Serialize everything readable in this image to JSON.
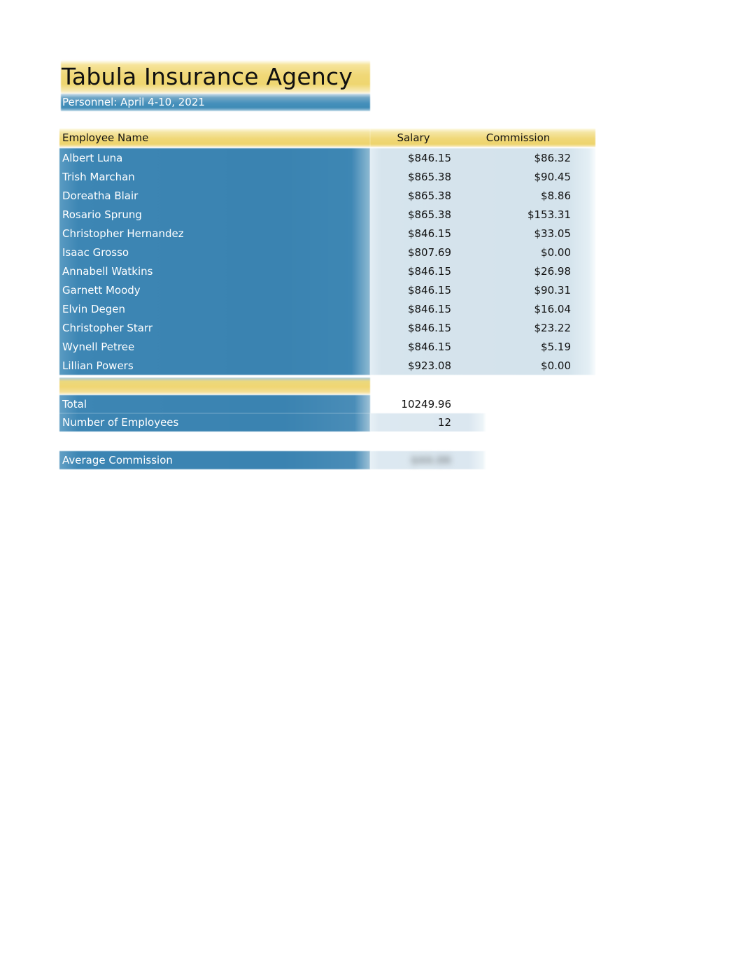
{
  "document": {
    "title": "Tabula Insurance Agency",
    "subtitle": "Personnel: April 4-10, 2021"
  },
  "table": {
    "headers": {
      "name": "Employee Name",
      "salary": "Salary",
      "commission": "Commission"
    },
    "rows": [
      {
        "name": "Albert Luna",
        "salary": "$846.15",
        "commission": "$86.32"
      },
      {
        "name": "Trish Marchan",
        "salary": "$865.38",
        "commission": "$90.45"
      },
      {
        "name": "Doreatha Blair",
        "salary": "$865.38",
        "commission": "$8.86"
      },
      {
        "name": "Rosario Sprung",
        "salary": "$865.38",
        "commission": "$153.31"
      },
      {
        "name": "Christopher Hernandez",
        "salary": "$846.15",
        "commission": "$33.05"
      },
      {
        "name": "Isaac Grosso",
        "salary": "$807.69",
        "commission": "$0.00"
      },
      {
        "name": "Annabell Watkins",
        "salary": "$846.15",
        "commission": "$26.98"
      },
      {
        "name": "Garnett Moody",
        "salary": "$846.15",
        "commission": "$90.31"
      },
      {
        "name": "Elvin Degen",
        "salary": "$846.15",
        "commission": "$16.04"
      },
      {
        "name": "Christopher Starr",
        "salary": "$846.15",
        "commission": "$23.22"
      },
      {
        "name": "Wynell Petree",
        "salary": "$846.15",
        "commission": "$5.19"
      },
      {
        "name": "Lillian Powers",
        "salary": "$923.08",
        "commission": "$0.00"
      }
    ]
  },
  "summary": {
    "total": {
      "label": "Total",
      "value": "10249.96"
    },
    "employee_count": {
      "label": "Number of Employees",
      "value": "12"
    },
    "average_commission": {
      "label": "Average Commission",
      "value": "$44.06"
    }
  },
  "colors": {
    "accent_blue": "#3d86b4",
    "accent_gold": "#f0d673",
    "tint_blue": "#d6e4ed",
    "text_light": "#ffffff",
    "text_dark": "#111111"
  }
}
